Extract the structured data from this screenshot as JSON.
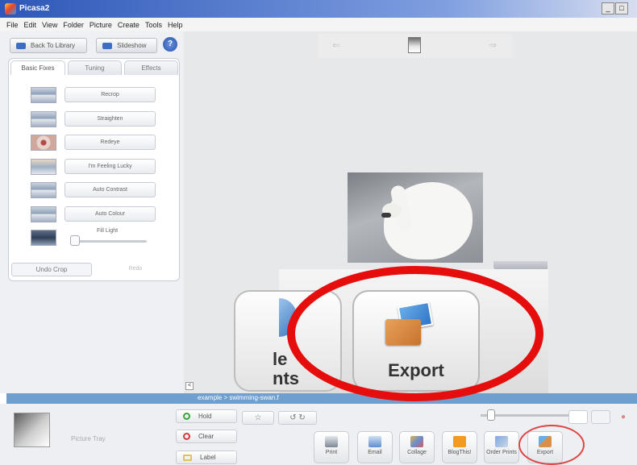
{
  "window": {
    "title": "Picasa2",
    "min": "_",
    "max": "□",
    "close": "×"
  },
  "menu": [
    "File",
    "Edit",
    "View",
    "Folder",
    "Picture",
    "Create",
    "Tools",
    "Help"
  ],
  "left": {
    "back_label": "Back To Library",
    "slideshow_label": "Slideshow",
    "help_label": "?",
    "tabs": [
      "Basic Fixes",
      "Tuning",
      "Effects"
    ],
    "edit_buttons": [
      "Recrop",
      "Straighten",
      "Redeye",
      "I'm Feeling Lucky",
      "Auto Contrast",
      "Auto Colour"
    ],
    "fill_light_label": "Fill Light",
    "fill_light_value": 0,
    "undo_label": "Undo Crop",
    "redo_label": "Redo"
  },
  "nav": {
    "prev": "⇐",
    "next": "⇒"
  },
  "zoom": {
    "partial_text_1": "le",
    "partial_text_2": "nts",
    "export_label": "Export"
  },
  "status": {
    "path": "example > swimming-swan.f"
  },
  "tray": {
    "label": "Picture Tray",
    "hold_label": "Hold",
    "clear_label": "Clear",
    "label_label": "Label",
    "rotate_left": "↺",
    "rotate_right": "↻",
    "star": "☆"
  },
  "actions": [
    "Print",
    "Email",
    "Collage",
    "BlogThis!",
    "Order Prints",
    "Export"
  ],
  "colors": {
    "status_bar": "#6f9fcf",
    "highlight_circle": "#e60d0d",
    "accent": "#3c6fc4"
  }
}
